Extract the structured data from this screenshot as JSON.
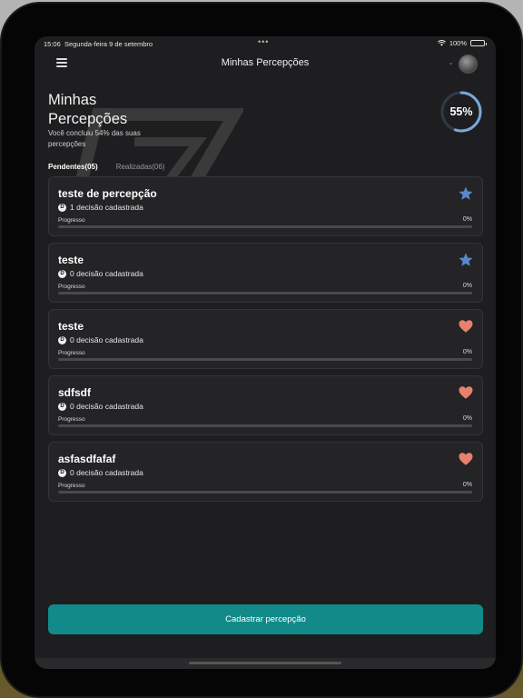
{
  "status": {
    "time": "15:06",
    "date": "Segunda-feira 9 de setembro",
    "battery": "100%"
  },
  "header": {
    "title": "Minhas Percepções"
  },
  "hero": {
    "title_line1": "Minhas",
    "title_line2": "Percepções",
    "subtitle": "Você concluiu 54% das suas percepções",
    "progress_text": "55%",
    "progress": 0.55
  },
  "tabs": [
    {
      "label": "Pendentes(05)"
    },
    {
      "label": "Realizadas(06)"
    }
  ],
  "cards": [
    {
      "title": "teste de percepção",
      "decisions": "1 decisão cadastrada",
      "progress_label": "Progresso",
      "progress_value": "0%",
      "icon": "star-icon"
    },
    {
      "title": "teste",
      "decisions": "0 decisão cadastrada",
      "progress_label": "Progresso",
      "progress_value": "0%",
      "icon": "star-icon"
    },
    {
      "title": "teste",
      "decisions": "0 decisão cadastrada",
      "progress_label": "Progresso",
      "progress_value": "0%",
      "icon": "heart-icon"
    },
    {
      "title": "sdfsdf",
      "decisions": "0 decisão cadastrada",
      "progress_label": "Progresso",
      "progress_value": "0%",
      "icon": "heart-icon"
    },
    {
      "title": "asfasdfafaf",
      "decisions": "0 decisão cadastrada",
      "progress_label": "Progresso",
      "progress_value": "0%",
      "icon": "heart-icon"
    }
  ],
  "cta": {
    "label": "Cadastrar percepção"
  },
  "colors": {
    "accent": "#128a8a",
    "star": "#5b87c9",
    "heart": "#e8806f",
    "ring": "#7aa7d9"
  }
}
